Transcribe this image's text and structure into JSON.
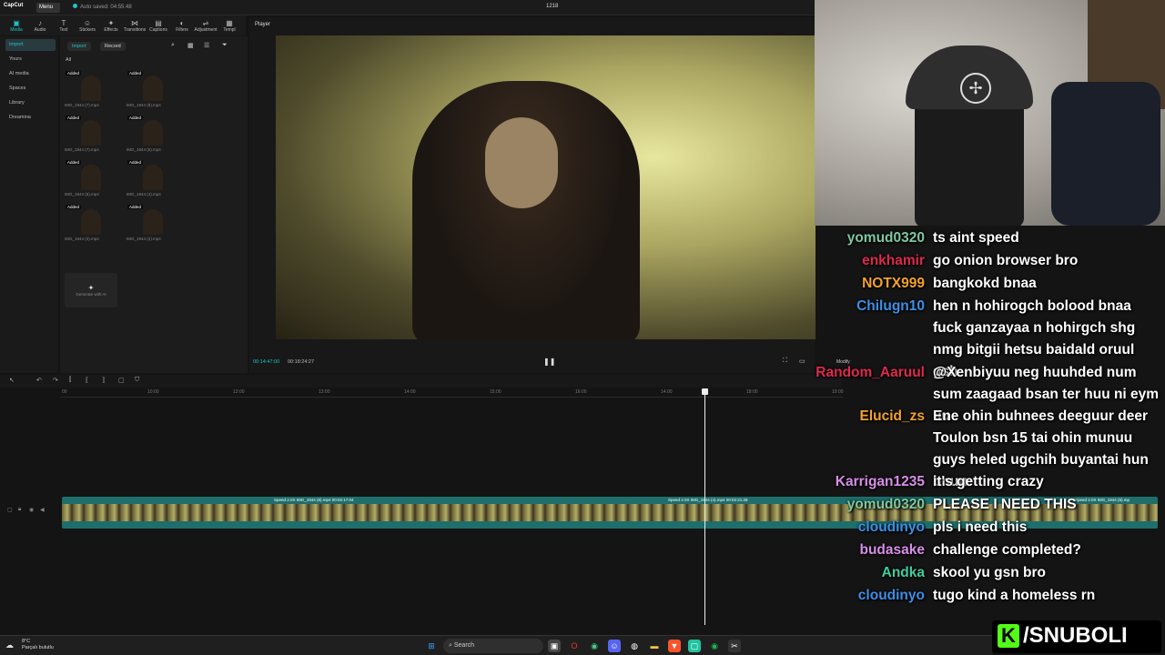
{
  "topbar": {
    "app": "CapCut",
    "menu": "Menu",
    "saved": "Auto saved: 04:55:48",
    "project": "1218"
  },
  "toolbar": [
    {
      "label": "Media",
      "icon": "media-icon",
      "glyph": "▣"
    },
    {
      "label": "Audio",
      "icon": "audio-icon",
      "glyph": "♪"
    },
    {
      "label": "Text",
      "icon": "text-icon",
      "glyph": "T"
    },
    {
      "label": "Stickers",
      "icon": "sticker-icon",
      "glyph": "☺"
    },
    {
      "label": "Effects",
      "icon": "effects-icon",
      "glyph": "✦"
    },
    {
      "label": "Transitions",
      "icon": "transitions-icon",
      "glyph": "⋈"
    },
    {
      "label": "Captions",
      "icon": "captions-icon",
      "glyph": "▤"
    },
    {
      "label": "Filters",
      "icon": "filters-icon",
      "glyph": "◐"
    },
    {
      "label": "Adjustment",
      "icon": "adjustment-icon",
      "glyph": "⇌"
    },
    {
      "label": "Templ",
      "icon": "template-icon",
      "glyph": "▦"
    }
  ],
  "leftnav": [
    "Import",
    "Yours",
    "AI media",
    "Spaces",
    "Library",
    "Dreamina"
  ],
  "media": {
    "import": "Import",
    "record": "Record",
    "all": "All",
    "generate": "Generate with AI",
    "badge": "Added",
    "clips": [
      "IMG_1944 (7).mp4",
      "IMG_1944 (8).mp4",
      "IMG_1944 (7).mp4",
      "IMG_1944 (6).mp4",
      "IMG_1944 (5).mp4",
      "IMG_1944 (4).mp4",
      "IMG_1944 (3).mp4",
      "IMG_1944 (2).mp4"
    ]
  },
  "player": {
    "title": "Player",
    "current": "00:14:47:00",
    "total": "00:18:24:27",
    "modify": "Modify"
  },
  "ruler": [
    "00",
    "10:00",
    "12:00",
    "13:00",
    "14:00",
    "15:00",
    "16:00",
    "14:00",
    "18:00",
    "19:00"
  ],
  "track": {
    "seg1": "Speed 2.0X  IMG_1944 (6).mp4  00:02:17:04",
    "seg2": "Speed 2.0X  IMG_1944 (4).mp4  00:02:21:28",
    "seg3": "Speed 2.0X  IMG_1944 (6).mp"
  },
  "chat": [
    {
      "user": "yomud0320",
      "text": "ts aint speed",
      "color": "#7ec8a0"
    },
    {
      "user": "enkhamir",
      "text": "go onion browser bro",
      "color": "#e0294f"
    },
    {
      "user": "NOTX999",
      "text": "bangkokd bnaa",
      "color": "#f4a22d"
    },
    {
      "user": "Chilugn10",
      "text": "hen n hohirogch bolood bnaa fuck ganzayaa n hohirgch shg nmg bitgii hetsu baidald oruul gsh",
      "color": "#3c8fe6"
    },
    {
      "user": "Random_Aaruul",
      "text": "@Xenbiyuu neg huuhded num sum zaagaad bsan ter huu ni eym uu",
      "color": "#e0294f"
    },
    {
      "user": "Elucid_zs",
      "text": "Ene ohin buhnees deeguur deer Toulon bsn 15 tai ohin munuu guys heled ugchih buyantai hun bnuu",
      "color": "#f4a22d"
    },
    {
      "user": "Karrigan1235",
      "text": "it's getting crazy",
      "color": "#d78ee8"
    },
    {
      "user": "yomud0320",
      "text": "PLEASE I NEED THIS",
      "color": "#7ec8a0"
    },
    {
      "user": "cloudinyo",
      "text": "pls i need this",
      "color": "#3c8fe6"
    },
    {
      "user": "budasake",
      "text": "challenge completed?",
      "color": "#d78ee8"
    },
    {
      "user": "Andka",
      "text": "skool yu gsn bro",
      "color": "#3ccfa0"
    },
    {
      "user": "cloudinyo",
      "text": "tugo kind a homeless rn",
      "color": "#3c8fe6"
    }
  ],
  "tag": "/SNUBOLI",
  "taskbar": {
    "temp": "8°C",
    "weather": "Parçalı bulutlu",
    "search": "Search"
  }
}
